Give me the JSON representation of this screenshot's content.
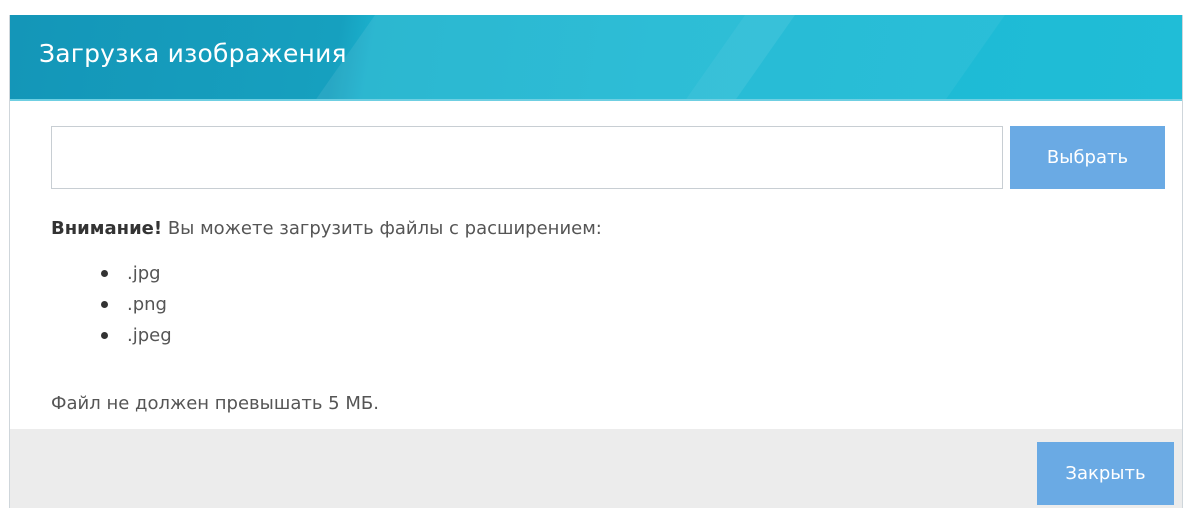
{
  "dialog": {
    "title": "Загрузка изображения"
  },
  "upload": {
    "file_value": "",
    "choose_label": "Выбрать"
  },
  "notice": {
    "bold": "Внимание!",
    "text": " Вы можете загрузить файлы с расширением:"
  },
  "extensions": [
    ".jpg",
    ".png",
    ".jpeg"
  ],
  "size_note": "Файл не должен превышать 5 МБ.",
  "footer": {
    "close_label": "Закрыть"
  },
  "colors": {
    "header": "#16a0bf",
    "button": "#6aaae4",
    "footer": "#ececec"
  }
}
